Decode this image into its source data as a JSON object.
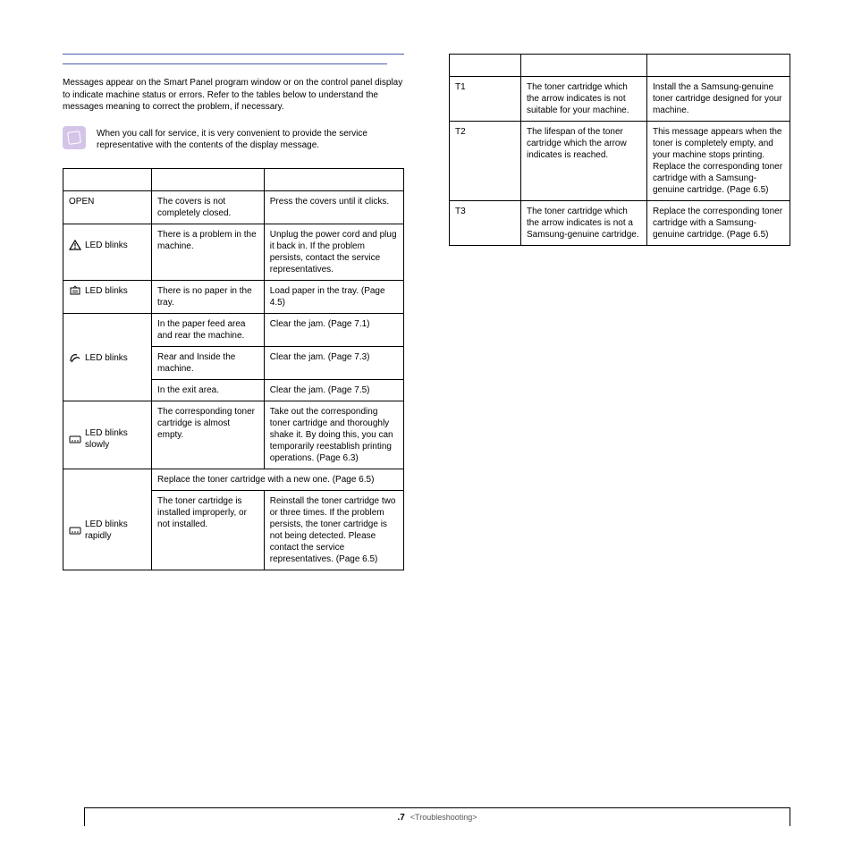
{
  "intro": "Messages appear on the Smart Panel program window or on the control panel display to indicate machine status or errors. Refer to the tables below to understand the messages meaning to correct the problem, if necessary.",
  "note": "When you call for service, it is very convenient to provide the service representative with the contents of the display message.",
  "left_table": {
    "rows": [
      {
        "c1": "OPEN",
        "c2": "The covers is not completely closed.",
        "c3": "Press the covers until it clicks."
      },
      {
        "icon": "warning-triangle-icon",
        "c1b": "LED blinks",
        "c2": "There is a problem in the machine.",
        "c3": "Unplug the power cord and plug it back in. If the problem persists, contact the service representatives."
      },
      {
        "icon": "paper-tray-icon",
        "c1b": "LED blinks",
        "c2": "There is no paper in the tray.",
        "c3": "Load paper in the tray. (Page 4.5)"
      },
      {
        "icon": "paper-jam-icon",
        "c1b": "LED blinks",
        "rowspan": "3",
        "subrows": [
          {
            "c2": "In the paper feed area and rear the machine.",
            "c3": "Clear the jam. (Page 7.1)"
          },
          {
            "c2": "Rear and Inside the machine.",
            "c3": "Clear the jam. (Page 7.3)"
          },
          {
            "c2": "In the exit area.",
            "c3": "Clear the jam. (Page 7.5)"
          }
        ]
      },
      {
        "icon": "toner-icon",
        "c1b": "LED blinks slowly",
        "c2": "The corresponding toner cartridge is almost empty.",
        "c3": "Take out the corresponding toner cartridge and thoroughly shake it. By doing this, you can temporarily reestablish printing operations. (Page 6.3)"
      },
      {
        "icon": "toner-icon",
        "c1b": "LED blinks rapidly",
        "rowspan": "2",
        "merged": "Replace the toner cartridge with a new one. (Page 6.5)",
        "subrows": [
          {
            "c2": "The toner cartridge is installed improperly, or not installed.",
            "c3": "Reinstall the toner cartridge two or three times. If the problem persists, the toner cartridge is not being detected. Please contact the service representatives. (Page 6.5)"
          }
        ]
      }
    ]
  },
  "right_table": {
    "rows": [
      {
        "c1": "T1",
        "c2": "The toner cartridge which the arrow indicates is not suitable for your machine.",
        "c3": "Install the a Samsung-genuine toner cartridge designed for your machine."
      },
      {
        "c1": "T2",
        "c2": "The lifespan of the toner cartridge which the arrow indicates is reached.",
        "c3": "This message appears when the toner is completely empty, and your machine stops printing. Replace the corresponding toner cartridge with a Samsung-genuine cartridge. (Page 6.5)"
      },
      {
        "c1": "T3",
        "c2": "The toner cartridge which the arrow indicates is not a Samsung-genuine cartridge.",
        "c3": "Replace the corresponding toner cartridge with a Samsung-genuine cartridge. (Page 6.5)"
      }
    ]
  },
  "footer": {
    "page": ".7",
    "section": "<Troubleshooting>"
  }
}
